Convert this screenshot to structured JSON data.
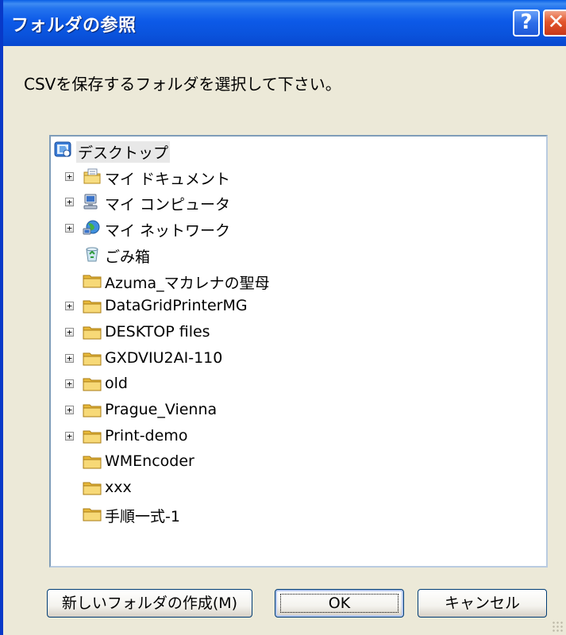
{
  "window": {
    "title": "フォルダの参照",
    "help_label": "?",
    "close_label": "✕"
  },
  "description": "CSVを保存するフォルダを選択して下さい。",
  "tree": {
    "items": [
      {
        "label": "デスクトップ",
        "icon": "desktop-icon",
        "expander": false,
        "selected": true
      },
      {
        "label": "マイ ドキュメント",
        "icon": "my-documents-icon",
        "expander": true
      },
      {
        "label": "マイ コンピュータ",
        "icon": "my-computer-icon",
        "expander": true
      },
      {
        "label": "マイ ネットワーク",
        "icon": "my-network-icon",
        "expander": true
      },
      {
        "label": "ごみ箱",
        "icon": "recycle-bin-icon",
        "expander": false
      },
      {
        "label": "Azuma_マカレナの聖母",
        "icon": "folder-icon",
        "expander": false
      },
      {
        "label": "DataGridPrinterMG",
        "icon": "folder-icon",
        "expander": true
      },
      {
        "label": "DESKTOP files",
        "icon": "folder-icon",
        "expander": true
      },
      {
        "label": "GXDVIU2AI-110",
        "icon": "folder-icon",
        "expander": true
      },
      {
        "label": "old",
        "icon": "folder-icon",
        "expander": true
      },
      {
        "label": "Prague_Vienna",
        "icon": "folder-icon",
        "expander": true
      },
      {
        "label": "Print-demo",
        "icon": "folder-icon",
        "expander": true
      },
      {
        "label": "WMEncoder",
        "icon": "folder-icon",
        "expander": false
      },
      {
        "label": "xxx",
        "icon": "folder-icon",
        "expander": false
      },
      {
        "label": "手順一式-1",
        "icon": "folder-icon",
        "expander": false
      }
    ],
    "expander_symbol": "+"
  },
  "buttons": {
    "new_folder": "新しいフォルダの作成(M)",
    "ok": "OK",
    "cancel": "キャンセル"
  },
  "colors": {
    "titlebar": "#0a53dc",
    "dialog_bg": "#ece9d8",
    "folder": "#f3d36b"
  }
}
